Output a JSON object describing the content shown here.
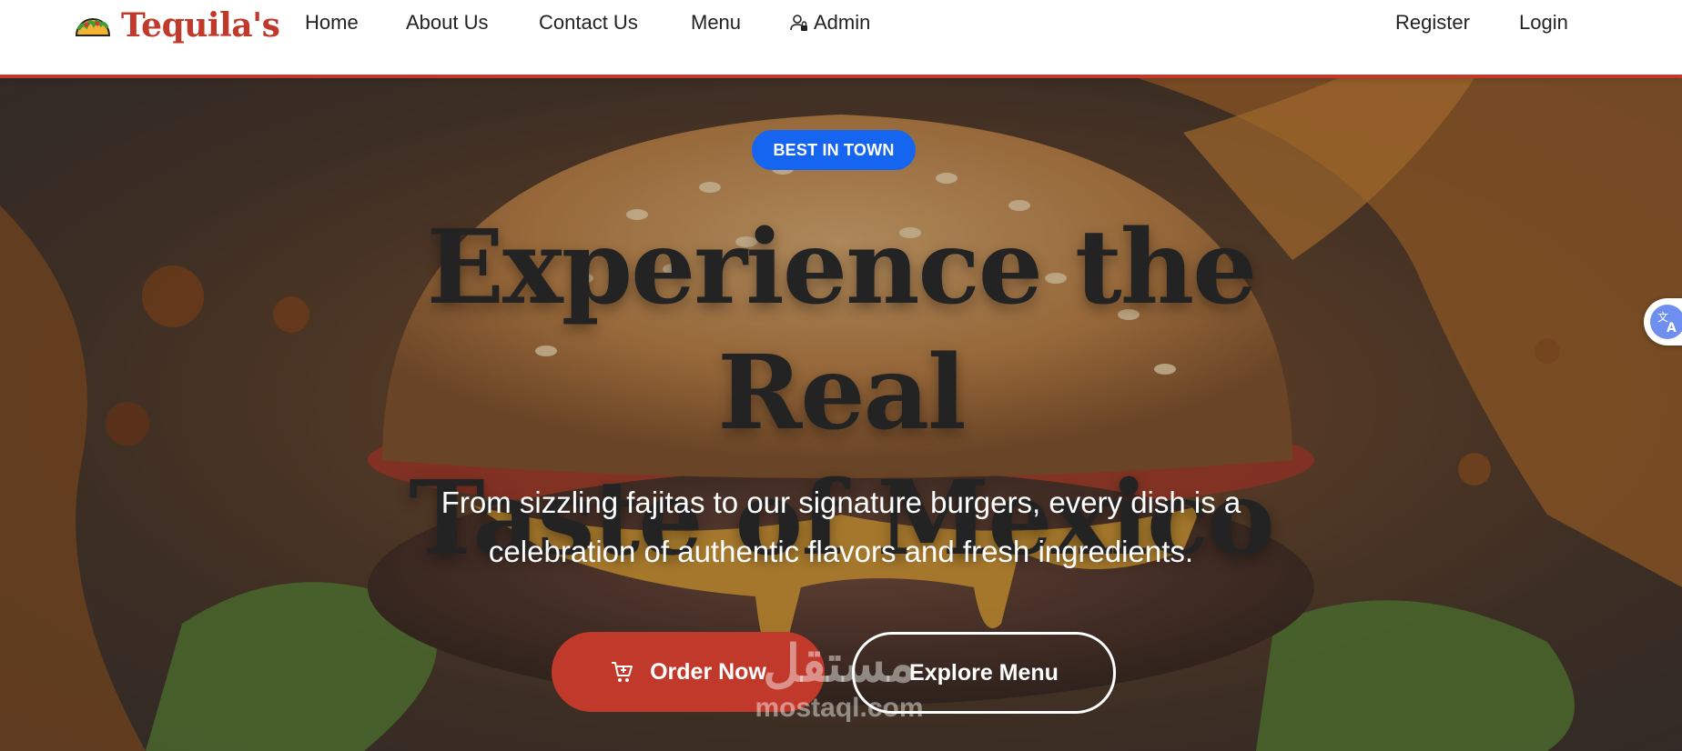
{
  "brand": {
    "name": "Tequila's",
    "icon": "taco-icon"
  },
  "nav": {
    "home": "Home",
    "about": "About Us",
    "contact": "Contact Us",
    "menu": "Menu",
    "admin": "Admin",
    "register": "Register",
    "login": "Login"
  },
  "hero": {
    "badge": "BEST IN TOWN",
    "headline_line1": "Experience the Real",
    "headline_line2": "Taste of Mexico",
    "subtext_line1": "From sizzling fajitas to our signature burgers, every dish is a",
    "subtext_line2": "celebration of authentic flavors and fresh ingredients.",
    "order_button": "Order Now",
    "explore_button": "Explore Menu",
    "background": "burger-splash-image"
  },
  "watermark": {
    "arabic": "مستقل",
    "latin": "mostaql.com"
  },
  "widgets": {
    "translate": "translate-icon"
  },
  "colors": {
    "accent": "#c0392b",
    "badge": "#1565f0",
    "text_dark": "#232323"
  }
}
